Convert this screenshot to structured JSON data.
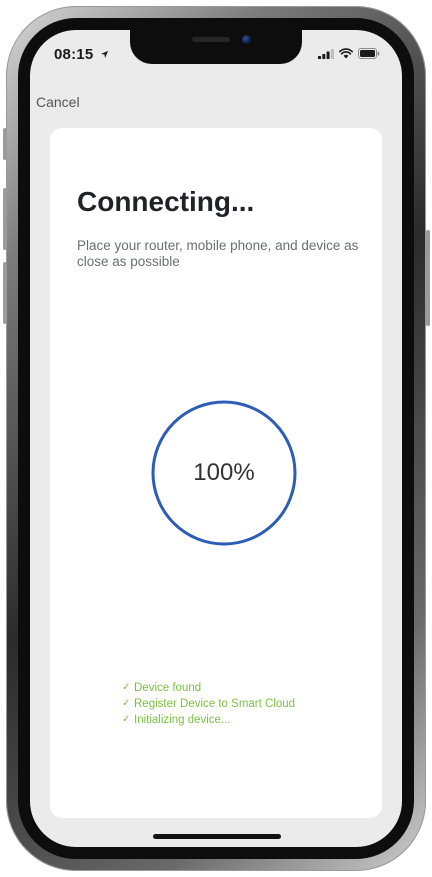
{
  "status_bar": {
    "time": "08:15",
    "location_icon": "location-arrow-icon",
    "signal_icon": "cellular-signal-icon",
    "wifi_icon": "wifi-icon",
    "battery_icon": "battery-icon"
  },
  "nav": {
    "cancel_label": "Cancel"
  },
  "content": {
    "title": "Connecting...",
    "subtitle": "Place your router, mobile phone, and device as close as possible",
    "progress": {
      "label": "100%",
      "value": 1.0,
      "color": "#2e5db8"
    },
    "steps": [
      {
        "label": "Device found"
      },
      {
        "label": "Register Device to Smart Cloud"
      },
      {
        "label": "Initializing device..."
      }
    ],
    "step_color": "#7bc242"
  }
}
